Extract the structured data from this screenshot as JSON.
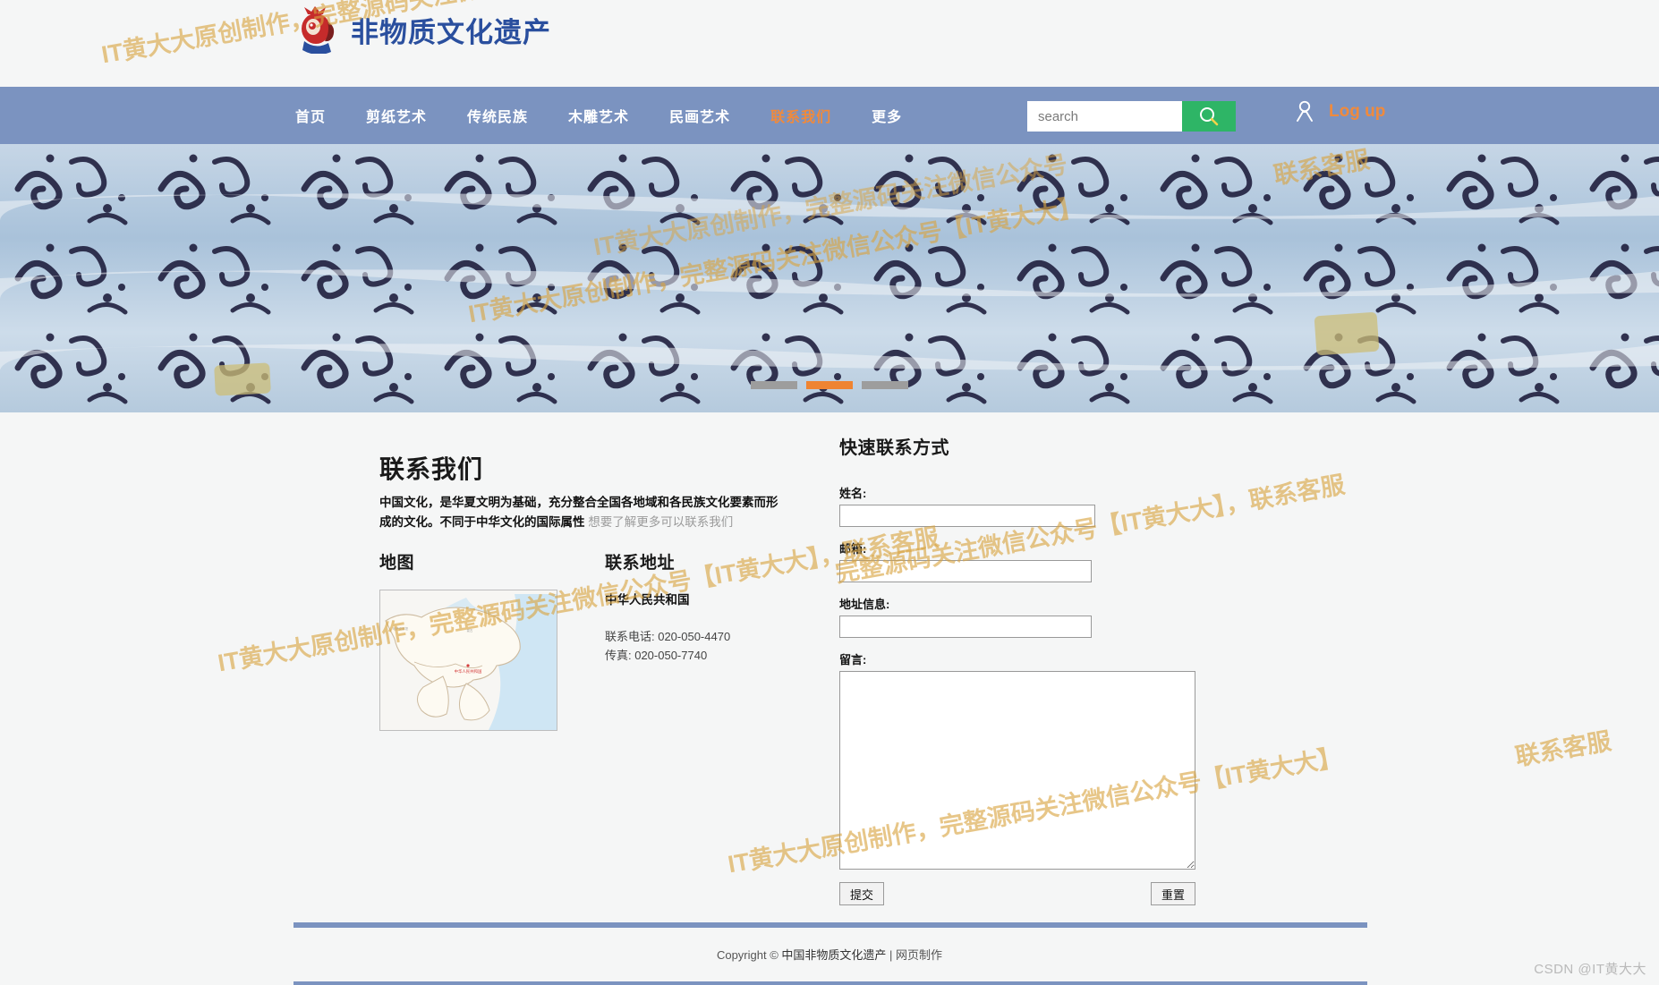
{
  "brand": {
    "logo_text": "非物质文化遗产",
    "mascot_icon": "mascot-icon"
  },
  "nav": {
    "items": [
      {
        "label": "首页",
        "active": false
      },
      {
        "label": "剪纸艺术",
        "active": false
      },
      {
        "label": "传统民族",
        "active": false
      },
      {
        "label": "木雕艺术",
        "active": false
      },
      {
        "label": "民画艺术",
        "active": false
      },
      {
        "label": "联系我们",
        "active": true
      },
      {
        "label": "更多",
        "active": false
      }
    ],
    "active_color": "#f08a3c",
    "bar_color": "#7b93c0"
  },
  "search": {
    "value": "",
    "placeholder": "search",
    "button_icon": "search-icon",
    "button_color": "#2eb566"
  },
  "account": {
    "avatar_icon": "user-icon",
    "login_label": "Log up",
    "login_color": "#f08a3c"
  },
  "hero": {
    "alt": "蓝色蜡染布匹传统纹样",
    "carousel": {
      "count": 3,
      "active_index": 1,
      "active_color": "#ef8432",
      "inactive_color": "#9d9d9d"
    }
  },
  "main": {
    "page_title": "联系我们",
    "intro_bold": "中国文化，是华夏文明为基础，充分整合全国各地域和各民族文化要素而形成的文化。不同于中华文化的国际属性",
    "intro_muted": "想要了解更多可以联系我们",
    "map": {
      "title": "地图",
      "alt": "中华人民共和国地图"
    },
    "address": {
      "title": "联系地址",
      "country": "中华人民共和国",
      "phone": "联系电话: 020-050-4470",
      "fax": "传真: 020-050-7740"
    },
    "form": {
      "title": "快速联系方式",
      "fields": [
        {
          "label": "姓名:",
          "value": "",
          "type": "text"
        },
        {
          "label": "邮箱:",
          "value": "",
          "type": "text"
        },
        {
          "label": "地址信息:",
          "value": "",
          "type": "text"
        },
        {
          "label": "留言:",
          "value": "",
          "type": "textarea"
        }
      ],
      "submit_label": "提交",
      "reset_label": "重置"
    }
  },
  "footer": {
    "copyright_prefix": "Copyright © ",
    "site_name": "中国非物质文化遗产",
    "separator": " | ",
    "credit": "网页制作",
    "rule_color": "#7b93c0"
  },
  "watermarks": {
    "line_a": "IT黄大大原创制作，完整源码关注微信公众号【IT黄大大】，联系客服",
    "line_b": "IT黄大大原创制作，完整源码关注微信公众号【IT黄大大】",
    "line_c": "完整源码关注微信公众号【IT黄大大】，联系客服",
    "line_d": "IT黄大大原创制作，完整源码关注微信公众号",
    "line_e": "联系客服",
    "csdn": "CSDN @IT黄大大"
  }
}
